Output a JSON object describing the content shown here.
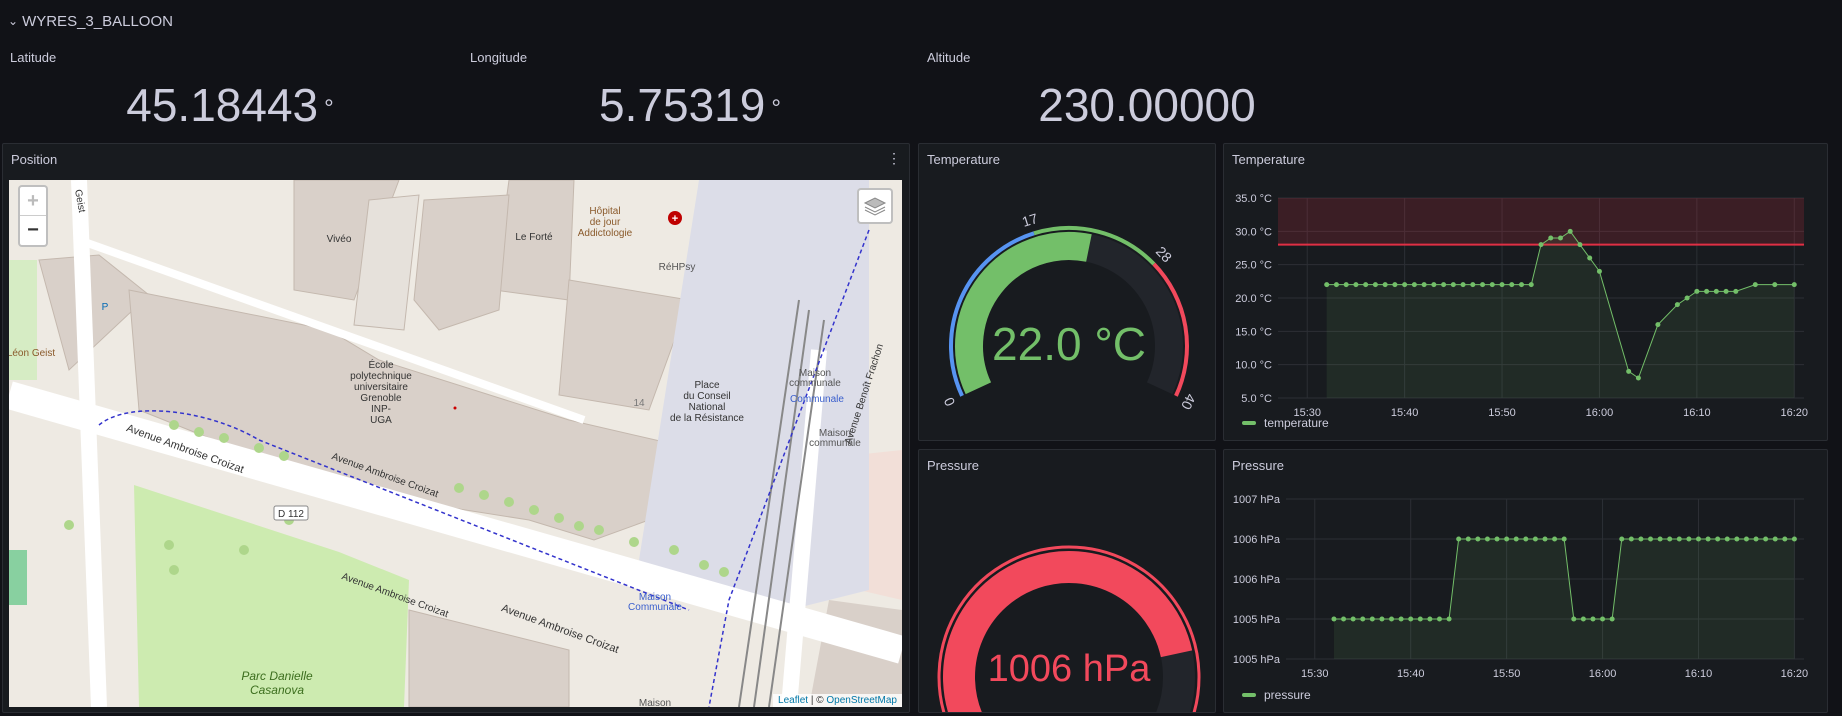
{
  "row": {
    "chevron": "⌄",
    "title": "WYRES_3_BALLOON"
  },
  "stats": {
    "latitude": {
      "label": "Latitude",
      "value": "45.18443",
      "unit": "°"
    },
    "longitude": {
      "label": "Longitude",
      "value": "5.75319",
      "unit": "°"
    },
    "altitude": {
      "label": "Altitude",
      "value": "230.00000"
    }
  },
  "position_panel": {
    "title": "Position",
    "menu_icon": "⋮",
    "zoom_in": "+",
    "zoom_out": "−",
    "map_labels": {
      "viveo": "Vivéo",
      "le_forte": "Le Forté",
      "hopital": "Hôpital de jour Addictologie",
      "hopital_l1": "Hôpital",
      "hopital_l2": "de jour",
      "hopital_l3": "Addictologie",
      "rehpsy": "RéHPsy",
      "ecole_l1": "École",
      "ecole_l2": "polytechnique",
      "ecole_l3": "universitaire",
      "ecole_l4": "Grenoble",
      "ecole_l5": "INP-",
      "ecole_l6": "UGA",
      "place_l1": "Place",
      "place_l2": "du Conseil",
      "place_l3": "National",
      "place_l4": "de la Résistance",
      "leon_geist": "Léon Geist",
      "geist": "Geist",
      "avenue1": "Avenue Ambroise Croizat",
      "avenue2": "Avenue Ambroise Croizat",
      "avenue3": "Avenue Ambroise Croizat",
      "avenue4": "Avenue Ambroise Croizat",
      "d112": "D 112",
      "parc_l1": "Parc Danielle",
      "parc_l2": "Casanova",
      "maison1_l1": "Maison",
      "maison1_l2": "communale",
      "communale": "Communale",
      "maison2_l1": "Maison",
      "maison2_l2": "communale",
      "maison3_l1": "Maison",
      "maison3_l2": "Communale",
      "maison4": "Maison",
      "benoit": "Avenue Benoît Frachon",
      "num14": "14",
      "p": "P"
    },
    "attribution_leaflet": "Leaflet",
    "attribution_sep": " | © ",
    "attribution_osm": "OpenStreetMap"
  },
  "temperature_gauge": {
    "title": "Temperature",
    "display": "22.0 °C",
    "value": 22.0,
    "min": 0,
    "max": 40,
    "thresholds": [
      17,
      28
    ],
    "tick_labels": [
      "0",
      "17",
      "28",
      "40"
    ],
    "colors": {
      "low": "#5794f2",
      "mid": "#73bf69",
      "high": "#f2495c",
      "value": "#73bf69"
    }
  },
  "pressure_gauge": {
    "title": "Pressure",
    "display": "1006 hPa",
    "value": 1006,
    "min": 0,
    "max": 1200,
    "colors": {
      "value": "#f2495c",
      "track": "#22252b"
    }
  },
  "temperature_chart": {
    "title": "Temperature",
    "legend": "temperature",
    "color": "#73bf69",
    "threshold_color": "#e02f44",
    "y_tick_labels": [
      "35.0 °C",
      "30.0 °C",
      "25.0 °C",
      "20.0 °C",
      "15.0 °C",
      "10.0 °C",
      "5.0 °C"
    ],
    "x_tick_labels": [
      "15:30",
      "15:40",
      "15:50",
      "16:00",
      "16:10",
      "16:20"
    ]
  },
  "pressure_chart": {
    "title": "Pressure",
    "legend": "pressure",
    "color": "#73bf69",
    "y_tick_labels": [
      "1007 hPa",
      "1006 hPa",
      "1006 hPa",
      "1005 hPa",
      "1005 hPa"
    ],
    "x_tick_labels": [
      "15:30",
      "15:40",
      "15:50",
      "16:00",
      "16:10",
      "16:20"
    ]
  },
  "chart_data": [
    {
      "type": "line",
      "title": "Temperature",
      "series": [
        {
          "name": "temperature",
          "x": [
            "15:32",
            "15:33",
            "15:34",
            "15:35",
            "15:36",
            "15:37",
            "15:38",
            "15:39",
            "15:40",
            "15:41",
            "15:42",
            "15:43",
            "15:44",
            "15:45",
            "15:46",
            "15:47",
            "15:48",
            "15:49",
            "15:50",
            "15:51",
            "15:52",
            "15:53",
            "15:54",
            "15:55",
            "15:56",
            "15:57",
            "15:58",
            "15:59",
            "16:00",
            "16:01",
            "16:02",
            "16:03",
            "16:04",
            "16:05",
            "16:06",
            "16:07",
            "16:08",
            "16:09",
            "16:10",
            "16:11",
            "16:12",
            "16:13",
            "16:14",
            "16:15",
            "16:16",
            "16:17",
            "16:18",
            "16:19",
            "16:20"
          ],
          "values": [
            22,
            22,
            22,
            22,
            22,
            22,
            22,
            22,
            22,
            22,
            22,
            22,
            22,
            22,
            22,
            22,
            22,
            22,
            22,
            22,
            22,
            22,
            28,
            29,
            29,
            30,
            28,
            26,
            24,
            null,
            null,
            9,
            8,
            null,
            16,
            null,
            19,
            20,
            21,
            21,
            21,
            21,
            21,
            null,
            22,
            null,
            22,
            null,
            22
          ]
        }
      ],
      "ylabel": "",
      "xlabel": "",
      "ylim": [
        5,
        35
      ],
      "threshold": 28,
      "grid": true,
      "legend_position": "bottom-left"
    },
    {
      "type": "line",
      "title": "Pressure",
      "series": [
        {
          "name": "pressure",
          "x": [
            "15:32",
            "15:33",
            "15:34",
            "15:35",
            "15:36",
            "15:37",
            "15:38",
            "15:39",
            "15:40",
            "15:41",
            "15:42",
            "15:43",
            "15:44",
            "15:45",
            "15:46",
            "15:47",
            "15:48",
            "15:49",
            "15:50",
            "15:51",
            "15:52",
            "15:53",
            "15:54",
            "15:55",
            "15:56",
            "15:57",
            "15:58",
            "15:59",
            "16:00",
            "16:01",
            "16:02",
            "16:03",
            "16:04",
            "16:05",
            "16:06",
            "16:07",
            "16:08",
            "16:09",
            "16:10",
            "16:11",
            "16:12",
            "16:13",
            "16:14",
            "16:15",
            "16:16",
            "16:17",
            "16:18",
            "16:19",
            "16:20"
          ],
          "values": [
            1005,
            1005,
            1005,
            1005,
            1005,
            1005,
            1005,
            1005,
            1005,
            1005,
            1005,
            1005,
            1005,
            1006,
            1006,
            1006,
            1006,
            1006,
            1006,
            1006,
            1006,
            1006,
            1006,
            1006,
            1006,
            1005,
            1005,
            1005,
            1005,
            1005,
            1006,
            1006,
            1006,
            1006,
            1006,
            1006,
            1006,
            1006,
            1006,
            1006,
            1006,
            1006,
            1006,
            1006,
            1006,
            1006,
            1006,
            1006,
            1006
          ]
        }
      ],
      "ylabel": "",
      "xlabel": "",
      "ylim": [
        1004.5,
        1006.5
      ],
      "grid": true,
      "legend_position": "bottom-left"
    }
  ]
}
